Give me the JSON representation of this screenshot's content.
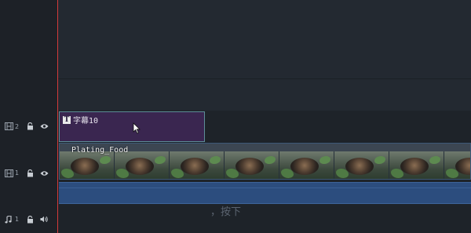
{
  "colors": {
    "playhead": "#d33a3a",
    "subtitle_clip": "#3a2650",
    "video_clip_border": "#3d5876",
    "audio_clip": "#2c4d7e"
  },
  "tracks": {
    "subtitle": {
      "number": "2",
      "icon": "film-strip-icon",
      "clip_title": "字幕10"
    },
    "video": {
      "number": "1",
      "icon": "film-strip-icon",
      "clip_label": "Plating_Food"
    },
    "audio": {
      "number": "1",
      "icon": "music-note-icon"
    }
  },
  "overlay_text": "，按下"
}
